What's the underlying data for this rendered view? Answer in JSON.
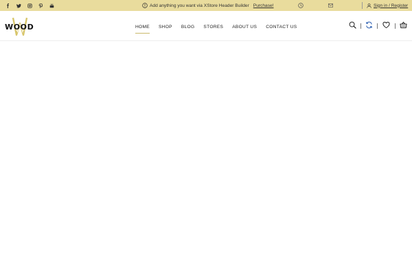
{
  "topbar": {
    "social": [
      {
        "icon": "facebook-icon"
      },
      {
        "icon": "twitter-icon"
      },
      {
        "icon": "instagram-icon"
      },
      {
        "icon": "pinterest-icon"
      },
      {
        "icon": "youtube-icon"
      }
    ],
    "promo_text": "Add anything you want via XStore Header Builder",
    "purchase_label": "Purchase!",
    "signin_label": "Sign in / Register",
    "background": "#e9dc9d"
  },
  "header": {
    "logo_text": "WOOD",
    "nav": [
      {
        "label": "HOME",
        "active": true
      },
      {
        "label": "SHOP"
      },
      {
        "label": "BLOG"
      },
      {
        "label": "STORES"
      },
      {
        "label": "ABOUT US"
      },
      {
        "label": "CONTACT US"
      }
    ],
    "icons": [
      "search-icon",
      "refresh-icon",
      "heart-icon",
      "basket-icon"
    ],
    "accent": "#c9b86a"
  }
}
